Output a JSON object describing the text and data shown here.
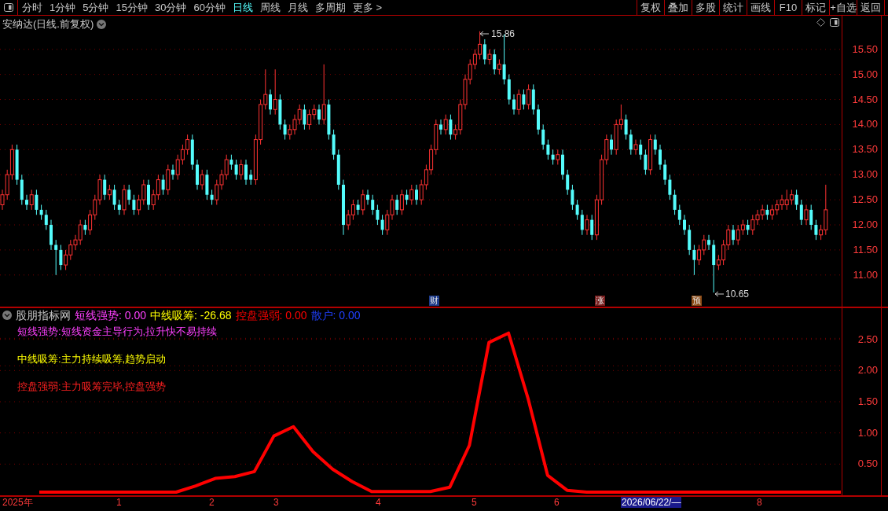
{
  "toolbar": {
    "periods": [
      {
        "label": "分时",
        "selected": false
      },
      {
        "label": "1分钟",
        "selected": false
      },
      {
        "label": "5分钟",
        "selected": false
      },
      {
        "label": "15分钟",
        "selected": false
      },
      {
        "label": "30分钟",
        "selected": false
      },
      {
        "label": "60分钟",
        "selected": false
      },
      {
        "label": "日线",
        "selected": true
      },
      {
        "label": "周线",
        "selected": false
      },
      {
        "label": "月线",
        "selected": false
      },
      {
        "label": "多周期",
        "selected": false
      }
    ],
    "more": "更多 >",
    "buttons": [
      "复权",
      "叠加",
      "多股",
      "统计",
      "画线",
      "F10",
      "标记",
      "+自选",
      "返回"
    ]
  },
  "main_chart": {
    "title": "安纳达(日线.前复权)",
    "high_label": "15.86",
    "low_label": "10.65",
    "markers": [
      {
        "label": "财",
        "color": "#1e3c8c"
      },
      {
        "label": "涨",
        "color": "#7a1e1e"
      },
      {
        "label": "预",
        "color": "#8c4a14"
      }
    ],
    "chart_data": {
      "type": "candlestick",
      "grid": true,
      "categories": [
        null,
        null,
        null,
        null,
        null,
        null,
        null,
        null,
        null,
        null,
        null,
        null,
        null,
        null,
        null,
        null,
        null,
        null,
        null,
        null,
        null,
        null,
        null,
        null,
        null,
        null,
        null,
        null,
        null,
        null,
        null,
        null,
        null,
        null,
        null,
        null,
        null,
        null,
        null,
        null,
        null,
        null,
        null,
        null,
        null,
        null,
        null,
        null,
        null,
        null,
        null,
        null,
        null,
        null,
        null,
        null,
        null,
        null,
        null,
        null,
        null,
        null,
        null,
        null,
        null,
        null,
        null,
        null,
        null,
        null,
        null,
        null,
        null,
        null,
        null,
        null,
        null,
        null,
        null,
        null,
        null,
        null,
        null,
        null,
        null,
        null,
        null,
        null,
        null,
        null,
        null,
        null,
        null,
        null,
        null,
        null,
        null,
        null,
        null,
        null,
        null,
        null,
        null,
        null,
        null,
        null,
        null,
        null,
        null,
        null,
        null,
        null,
        null,
        null,
        null,
        null,
        null,
        null,
        null,
        null,
        null,
        null,
        null,
        null,
        null,
        null,
        null,
        null,
        null,
        null,
        null,
        null,
        null,
        null,
        null,
        null,
        null,
        null,
        null,
        null,
        null,
        null,
        null,
        null,
        null,
        null,
        null,
        null,
        null,
        null,
        null,
        null,
        null,
        null,
        null,
        null,
        null,
        null,
        null,
        null,
        null,
        null,
        null,
        null,
        null,
        null,
        null,
        null,
        null,
        null
      ],
      "ohlc": [
        [
          12.4,
          12.7,
          12.3,
          12.6
        ],
        [
          12.6,
          13.1,
          12.5,
          13.0
        ],
        [
          13.0,
          13.6,
          12.9,
          13.5
        ],
        [
          13.5,
          13.6,
          12.8,
          12.9
        ],
        [
          12.9,
          13.0,
          12.4,
          12.5
        ],
        [
          12.5,
          12.6,
          12.3,
          12.4
        ],
        [
          12.4,
          12.7,
          12.3,
          12.6
        ],
        [
          12.6,
          12.7,
          12.2,
          12.3
        ],
        [
          12.3,
          12.4,
          12.1,
          12.2
        ],
        [
          12.2,
          12.3,
          11.9,
          12.0
        ],
        [
          12.0,
          12.1,
          11.5,
          11.6
        ],
        [
          11.6,
          11.7,
          11.0,
          11.5
        ],
        [
          11.5,
          11.6,
          11.1,
          11.2
        ],
        [
          11.2,
          11.5,
          11.1,
          11.4
        ],
        [
          11.4,
          11.7,
          11.3,
          11.6
        ],
        [
          11.6,
          11.8,
          11.5,
          11.7
        ],
        [
          11.7,
          12.1,
          11.6,
          12.0
        ],
        [
          12.0,
          12.1,
          11.8,
          11.9
        ],
        [
          11.9,
          12.3,
          11.8,
          12.2
        ],
        [
          12.2,
          12.6,
          12.1,
          12.5
        ],
        [
          12.5,
          13.0,
          12.4,
          12.9
        ],
        [
          12.9,
          13.0,
          12.5,
          12.6
        ],
        [
          12.6,
          12.8,
          12.5,
          12.7
        ],
        [
          12.7,
          12.8,
          12.3,
          12.4
        ],
        [
          12.4,
          12.5,
          12.2,
          12.3
        ],
        [
          12.3,
          12.8,
          12.2,
          12.7
        ],
        [
          12.7,
          12.8,
          12.4,
          12.5
        ],
        [
          12.5,
          12.6,
          12.2,
          12.3
        ],
        [
          12.3,
          12.6,
          12.2,
          12.5
        ],
        [
          12.5,
          12.9,
          12.4,
          12.8
        ],
        [
          12.8,
          12.9,
          12.3,
          12.4
        ],
        [
          12.4,
          12.7,
          12.3,
          12.6
        ],
        [
          12.6,
          13.0,
          12.5,
          12.9
        ],
        [
          12.9,
          13.0,
          12.6,
          12.7
        ],
        [
          12.7,
          13.2,
          12.6,
          13.1
        ],
        [
          13.1,
          13.2,
          12.9,
          13.0
        ],
        [
          13.0,
          13.4,
          12.9,
          13.3
        ],
        [
          13.3,
          13.6,
          13.2,
          13.5
        ],
        [
          13.5,
          13.8,
          13.4,
          13.7
        ],
        [
          13.7,
          13.8,
          13.1,
          13.2
        ],
        [
          13.2,
          13.3,
          12.7,
          12.8
        ],
        [
          12.8,
          13.1,
          12.7,
          13.0
        ],
        [
          13.0,
          13.1,
          12.5,
          12.6
        ],
        [
          12.6,
          12.7,
          12.4,
          12.5
        ],
        [
          12.5,
          12.9,
          12.4,
          12.8
        ],
        [
          12.8,
          13.1,
          12.7,
          13.0
        ],
        [
          13.0,
          13.4,
          12.9,
          13.3
        ],
        [
          13.3,
          13.4,
          13.1,
          13.2
        ],
        [
          13.2,
          13.3,
          12.9,
          13.0
        ],
        [
          13.0,
          13.3,
          12.9,
          13.2
        ],
        [
          13.2,
          13.3,
          12.8,
          12.9
        ],
        [
          13.0,
          13.1,
          12.8,
          12.9
        ],
        [
          12.9,
          13.8,
          12.8,
          13.7
        ],
        [
          13.7,
          14.5,
          13.6,
          14.4
        ],
        [
          14.4,
          15.1,
          14.3,
          14.6
        ],
        [
          14.6,
          14.7,
          14.2,
          14.3
        ],
        [
          14.3,
          15.1,
          14.2,
          14.5
        ],
        [
          14.5,
          14.6,
          13.9,
          14.0
        ],
        [
          14.0,
          14.1,
          13.7,
          13.8
        ],
        [
          13.8,
          14.0,
          13.7,
          13.9
        ],
        [
          13.9,
          14.2,
          13.8,
          14.1
        ],
        [
          14.1,
          14.4,
          14.0,
          14.3
        ],
        [
          14.3,
          14.4,
          13.9,
          14.0
        ],
        [
          14.0,
          14.3,
          13.9,
          14.2
        ],
        [
          14.2,
          14.4,
          14.1,
          14.3
        ],
        [
          14.3,
          14.4,
          14.0,
          14.1
        ],
        [
          14.1,
          15.2,
          14.0,
          14.4
        ],
        [
          14.4,
          14.5,
          13.7,
          13.8
        ],
        [
          13.8,
          13.9,
          13.3,
          13.4
        ],
        [
          13.4,
          13.5,
          12.7,
          12.8
        ],
        [
          12.8,
          12.9,
          11.8,
          12.0
        ],
        [
          12.0,
          12.3,
          11.9,
          12.2
        ],
        [
          12.2,
          12.5,
          12.1,
          12.4
        ],
        [
          12.4,
          12.5,
          12.2,
          12.3
        ],
        [
          12.3,
          12.7,
          12.2,
          12.6
        ],
        [
          12.6,
          12.7,
          12.4,
          12.5
        ],
        [
          12.5,
          12.6,
          12.2,
          12.3
        ],
        [
          12.3,
          12.4,
          12.0,
          12.1
        ],
        [
          12.1,
          12.2,
          11.8,
          11.9
        ],
        [
          11.9,
          12.3,
          11.8,
          12.2
        ],
        [
          12.2,
          12.6,
          12.1,
          12.5
        ],
        [
          12.5,
          12.6,
          12.2,
          12.3
        ],
        [
          12.3,
          12.7,
          12.2,
          12.6
        ],
        [
          12.6,
          12.7,
          12.4,
          12.5
        ],
        [
          12.5,
          12.8,
          12.4,
          12.7
        ],
        [
          12.7,
          12.8,
          12.4,
          12.5
        ],
        [
          12.5,
          12.9,
          12.4,
          12.8
        ],
        [
          12.8,
          13.2,
          12.7,
          13.1
        ],
        [
          13.1,
          13.6,
          13.0,
          13.5
        ],
        [
          13.5,
          14.1,
          13.4,
          14.0
        ],
        [
          14.0,
          14.1,
          13.8,
          13.9
        ],
        [
          13.9,
          14.2,
          13.8,
          14.1
        ],
        [
          14.1,
          14.2,
          13.7,
          13.8
        ],
        [
          13.8,
          14.0,
          13.7,
          13.9
        ],
        [
          13.9,
          14.5,
          13.8,
          14.4
        ],
        [
          14.4,
          15.0,
          14.3,
          14.9
        ],
        [
          14.9,
          15.3,
          14.8,
          15.2
        ],
        [
          15.2,
          15.5,
          15.1,
          15.4
        ],
        [
          15.4,
          15.86,
          15.3,
          15.6
        ],
        [
          15.6,
          15.7,
          15.2,
          15.3
        ],
        [
          15.3,
          15.5,
          15.2,
          15.4
        ],
        [
          15.4,
          15.5,
          15.0,
          15.1
        ],
        [
          15.1,
          15.3,
          15.0,
          15.2
        ],
        [
          15.2,
          15.8,
          14.8,
          14.9
        ],
        [
          14.9,
          15.0,
          14.4,
          14.5
        ],
        [
          14.5,
          14.6,
          14.2,
          14.3
        ],
        [
          14.3,
          14.7,
          14.2,
          14.6
        ],
        [
          14.6,
          14.7,
          14.3,
          14.4
        ],
        [
          14.4,
          14.8,
          14.3,
          14.7
        ],
        [
          14.7,
          14.8,
          14.2,
          14.3
        ],
        [
          14.3,
          14.4,
          13.8,
          13.9
        ],
        [
          13.9,
          14.0,
          13.5,
          13.6
        ],
        [
          13.6,
          13.7,
          13.3,
          13.4
        ],
        [
          13.4,
          13.5,
          13.2,
          13.3
        ],
        [
          13.3,
          13.5,
          13.2,
          13.4
        ],
        [
          13.4,
          13.5,
          12.9,
          13.0
        ],
        [
          13.0,
          13.1,
          12.6,
          12.7
        ],
        [
          12.7,
          12.8,
          12.3,
          12.4
        ],
        [
          12.4,
          12.5,
          12.1,
          12.2
        ],
        [
          12.2,
          12.3,
          11.8,
          11.9
        ],
        [
          11.9,
          12.2,
          11.8,
          12.1
        ],
        [
          12.1,
          12.2,
          11.7,
          11.8
        ],
        [
          11.8,
          12.6,
          11.7,
          12.5
        ],
        [
          12.5,
          13.4,
          12.4,
          13.3
        ],
        [
          13.3,
          13.8,
          13.2,
          13.7
        ],
        [
          13.7,
          13.8,
          13.4,
          13.5
        ],
        [
          13.5,
          14.1,
          13.4,
          14.0
        ],
        [
          14.0,
          14.4,
          13.9,
          14.1
        ],
        [
          14.1,
          14.2,
          13.7,
          13.8
        ],
        [
          13.8,
          13.9,
          13.4,
          13.5
        ],
        [
          13.5,
          13.7,
          13.4,
          13.6
        ],
        [
          13.6,
          13.7,
          13.3,
          13.4
        ],
        [
          13.4,
          13.5,
          13.0,
          13.1
        ],
        [
          13.1,
          13.8,
          13.0,
          13.7
        ],
        [
          13.7,
          13.8,
          13.4,
          13.5
        ],
        [
          13.5,
          13.6,
          13.1,
          13.2
        ],
        [
          13.2,
          13.3,
          12.8,
          12.9
        ],
        [
          12.9,
          13.0,
          12.5,
          12.6
        ],
        [
          12.6,
          12.7,
          12.2,
          12.3
        ],
        [
          12.3,
          12.4,
          12.0,
          12.1
        ],
        [
          12.1,
          12.2,
          11.8,
          11.9
        ],
        [
          11.9,
          12.0,
          11.4,
          11.5
        ],
        [
          11.5,
          11.6,
          11.0,
          11.3
        ],
        [
          11.3,
          11.6,
          11.2,
          11.5
        ],
        [
          11.5,
          11.8,
          11.4,
          11.7
        ],
        [
          11.7,
          11.8,
          11.5,
          11.6
        ],
        [
          11.6,
          11.7,
          10.65,
          11.2
        ],
        [
          11.2,
          11.4,
          11.1,
          11.3
        ],
        [
          11.3,
          11.7,
          11.2,
          11.6
        ],
        [
          11.6,
          12.0,
          11.5,
          11.9
        ],
        [
          11.9,
          12.0,
          11.6,
          11.7
        ],
        [
          11.7,
          12.0,
          11.6,
          11.9
        ],
        [
          11.9,
          12.1,
          11.8,
          12.0
        ],
        [
          12.0,
          12.1,
          11.8,
          11.9
        ],
        [
          11.9,
          12.2,
          11.8,
          12.1
        ],
        [
          12.1,
          12.3,
          12.0,
          12.2
        ],
        [
          12.2,
          12.4,
          12.1,
          12.3
        ],
        [
          12.3,
          12.4,
          12.1,
          12.2
        ],
        [
          12.2,
          12.4,
          12.1,
          12.3
        ],
        [
          12.3,
          12.5,
          12.2,
          12.4
        ],
        [
          12.4,
          12.6,
          12.3,
          12.5
        ],
        [
          12.4,
          12.7,
          12.3,
          12.5
        ],
        [
          12.5,
          12.7,
          12.4,
          12.6
        ],
        [
          12.6,
          12.7,
          12.3,
          12.4
        ],
        [
          12.4,
          12.5,
          12.0,
          12.1
        ],
        [
          12.1,
          12.4,
          12.0,
          12.3
        ],
        [
          12.3,
          12.4,
          11.9,
          12.0
        ],
        [
          12.0,
          12.1,
          11.7,
          11.8
        ],
        [
          11.8,
          12.0,
          11.7,
          11.9
        ],
        [
          11.9,
          12.8,
          11.8,
          12.3
        ]
      ],
      "ylim": [
        10.37,
        16.17
      ],
      "yticks": [
        {
          "value": 15.5,
          "label": "15.50"
        },
        {
          "value": 15,
          "label": "15.00"
        },
        {
          "value": 14.5,
          "label": "14.50"
        },
        {
          "value": 14,
          "label": "14.00"
        },
        {
          "value": 13.5,
          "label": "13.50"
        },
        {
          "value": 13,
          "label": "13.00"
        },
        {
          "value": 12.5,
          "label": "12.50"
        },
        {
          "value": 12,
          "label": "12.00"
        },
        {
          "value": 11.5,
          "label": "11.50"
        },
        {
          "value": 11,
          "label": "11.00"
        }
      ]
    }
  },
  "indicator": {
    "name": "股朋指标网",
    "readings": [
      {
        "label": "短线强势: 0.00",
        "color": "#ff40ff"
      },
      {
        "label": "中线吸筹: -26.68",
        "color": "#ffff00"
      },
      {
        "label": "控盘强弱: 0.00",
        "color": "#ff0000"
      },
      {
        "label": "散户: 0.00",
        "color": "#2040ff"
      }
    ],
    "notes": [
      {
        "text": "短线强势:短线资金主导行为,拉升快不易持续",
        "color": "#ff40ff"
      },
      {
        "text": "中线吸筹:主力持续吸筹,趋势启动",
        "color": "#ffff00"
      },
      {
        "text": "控盘强弱:主力吸筹完毕,控盘强势",
        "color": "#ff2020"
      }
    ],
    "chart_data": {
      "type": "line",
      "grid": true,
      "categories": [
        null,
        null,
        null,
        null,
        null,
        null,
        null,
        null,
        null,
        null,
        null,
        null,
        null,
        null,
        null,
        null,
        null,
        null,
        null,
        null,
        null,
        null,
        null,
        null,
        null,
        null,
        null,
        null,
        null,
        null,
        null,
        null,
        null,
        null,
        null,
        null,
        null,
        null,
        null,
        null,
        null,
        null
      ],
      "series": [
        {
          "color": "#ff0000",
          "values": [
            0.05,
            0.05,
            0.05,
            0.05,
            0.05,
            0.05,
            0.05,
            0.05,
            0.15,
            0.27,
            0.3,
            0.38,
            0.95,
            1.1,
            0.7,
            0.42,
            0.22,
            0.06,
            0.06,
            0.06,
            0.06,
            0.13,
            0.8,
            2.45,
            2.6,
            1.55,
            0.32,
            0.08,
            0.05,
            0.05,
            0.05,
            0.05,
            0.05,
            0.05,
            0.05,
            0.05,
            0.05,
            0.05,
            0.05,
            0.05,
            0.05,
            0.05
          ]
        }
      ],
      "ylim": [
        0,
        3
      ],
      "yticks": [
        {
          "value": 0.5,
          "label": "0.50"
        },
        {
          "value": 1,
          "label": "1.00"
        },
        {
          "value": 1.5,
          "label": "1.50"
        },
        {
          "value": 2,
          "label": "2.00"
        },
        {
          "value": 2.5,
          "label": "2.50"
        }
      ]
    }
  },
  "time_axis": [
    {
      "label": "2025年",
      "highlighted": false
    },
    {
      "label": "1",
      "highlighted": false
    },
    {
      "label": "2",
      "highlighted": false
    },
    {
      "label": "3",
      "highlighted": false
    },
    {
      "label": "4",
      "highlighted": false
    },
    {
      "label": "5",
      "highlighted": false
    },
    {
      "label": "6",
      "highlighted": false
    },
    {
      "label": "2026/06/22/—",
      "highlighted": true
    },
    {
      "label": "8",
      "highlighted": false
    }
  ]
}
